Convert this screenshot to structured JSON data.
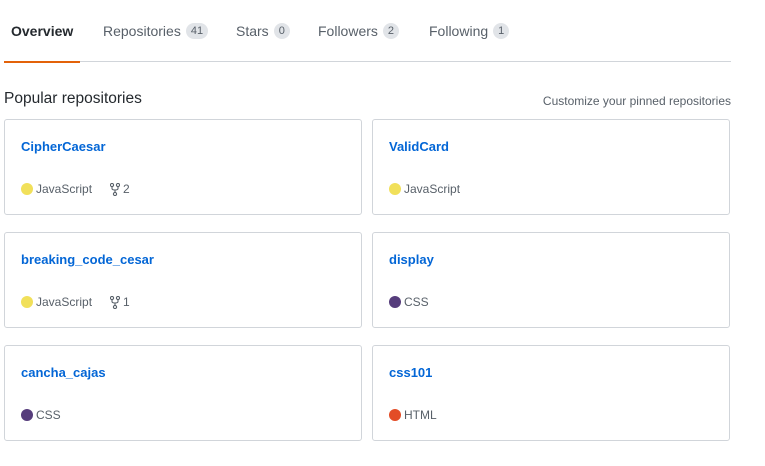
{
  "nav": {
    "tabs": [
      {
        "label": "Overview",
        "count": null,
        "selected": true
      },
      {
        "label": "Repositories",
        "count": "41"
      },
      {
        "label": "Stars",
        "count": "0"
      },
      {
        "label": "Followers",
        "count": "2"
      },
      {
        "label": "Following",
        "count": "1"
      }
    ],
    "active_underline_color": "#e36209"
  },
  "pinned": {
    "title": "Popular repositories",
    "customize_label": "Customize your pinned repositories",
    "repos": [
      {
        "name": "CipherCaesar",
        "language": "JavaScript",
        "language_color": "#f1e05a",
        "forks": "2"
      },
      {
        "name": "ValidCard",
        "language": "JavaScript",
        "language_color": "#f1e05a"
      },
      {
        "name": "breaking_code_cesar",
        "language": "JavaScript",
        "language_color": "#f1e05a",
        "forks": "1"
      },
      {
        "name": "display",
        "language": "CSS",
        "language_color": "#563d7c"
      },
      {
        "name": "cancha_cajas",
        "language": "CSS",
        "language_color": "#563d7c"
      },
      {
        "name": "css101",
        "language": "HTML",
        "language_color": "#e34c26"
      }
    ]
  },
  "icons": {
    "language_marker": "language-dot-icon",
    "fork": "fork-icon"
  }
}
